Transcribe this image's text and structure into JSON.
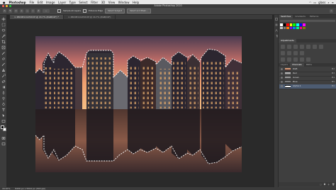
{
  "menubar": {
    "app": "Photoshop",
    "items": [
      "File",
      "Edit",
      "Image",
      "Layer",
      "Type",
      "Select",
      "Filter",
      "3D",
      "View",
      "Window",
      "Help"
    ],
    "user": "glass"
  },
  "window": {
    "title": "Adobe Photoshop 2020"
  },
  "options": {
    "btn1": "Sample All Layers",
    "btn2": "Enhance Edge",
    "btn3": "Select Subject",
    "btn4": "Select and Mask..."
  },
  "doc_tabs": [
    {
      "label": "Z6C08114-Edit.tif @ 16.7% (RGB/16*) *",
      "active": true
    },
    {
      "label": "Z6C08114-Edit.tif @ 16.7% (RGB/16*)",
      "active": false
    }
  ],
  "panels": {
    "swatches_tabs": [
      "Swatches",
      "Gradients",
      "Patterns"
    ],
    "adjustments_tab": "Adjustments",
    "channels_tabs": [
      "Layers",
      "Channels",
      "Paths"
    ],
    "swatch_colors": [
      "#ffffff",
      "#000000",
      "#ff0000",
      "#ffff00",
      "#00ff00",
      "#00ffff",
      "#0000ff",
      "#ff00ff",
      "#c0c0c0",
      "#808080",
      "#ff8000",
      "#8000ff",
      "#0080ff",
      "#00ff80",
      "#ff0080",
      "#808000"
    ],
    "channels": [
      {
        "name": "RGB",
        "key": "⌘2",
        "selected": false
      },
      {
        "name": "Red",
        "key": "⌘3",
        "selected": false
      },
      {
        "name": "Green",
        "key": "⌘4",
        "selected": false
      },
      {
        "name": "Blue",
        "key": "⌘5",
        "selected": false
      },
      {
        "name": "Alpha 1",
        "key": "⌘6",
        "selected": true
      }
    ]
  },
  "status": {
    "zoom": "16.67%",
    "info": "8256 px x 5504 px (300 ppi)"
  }
}
